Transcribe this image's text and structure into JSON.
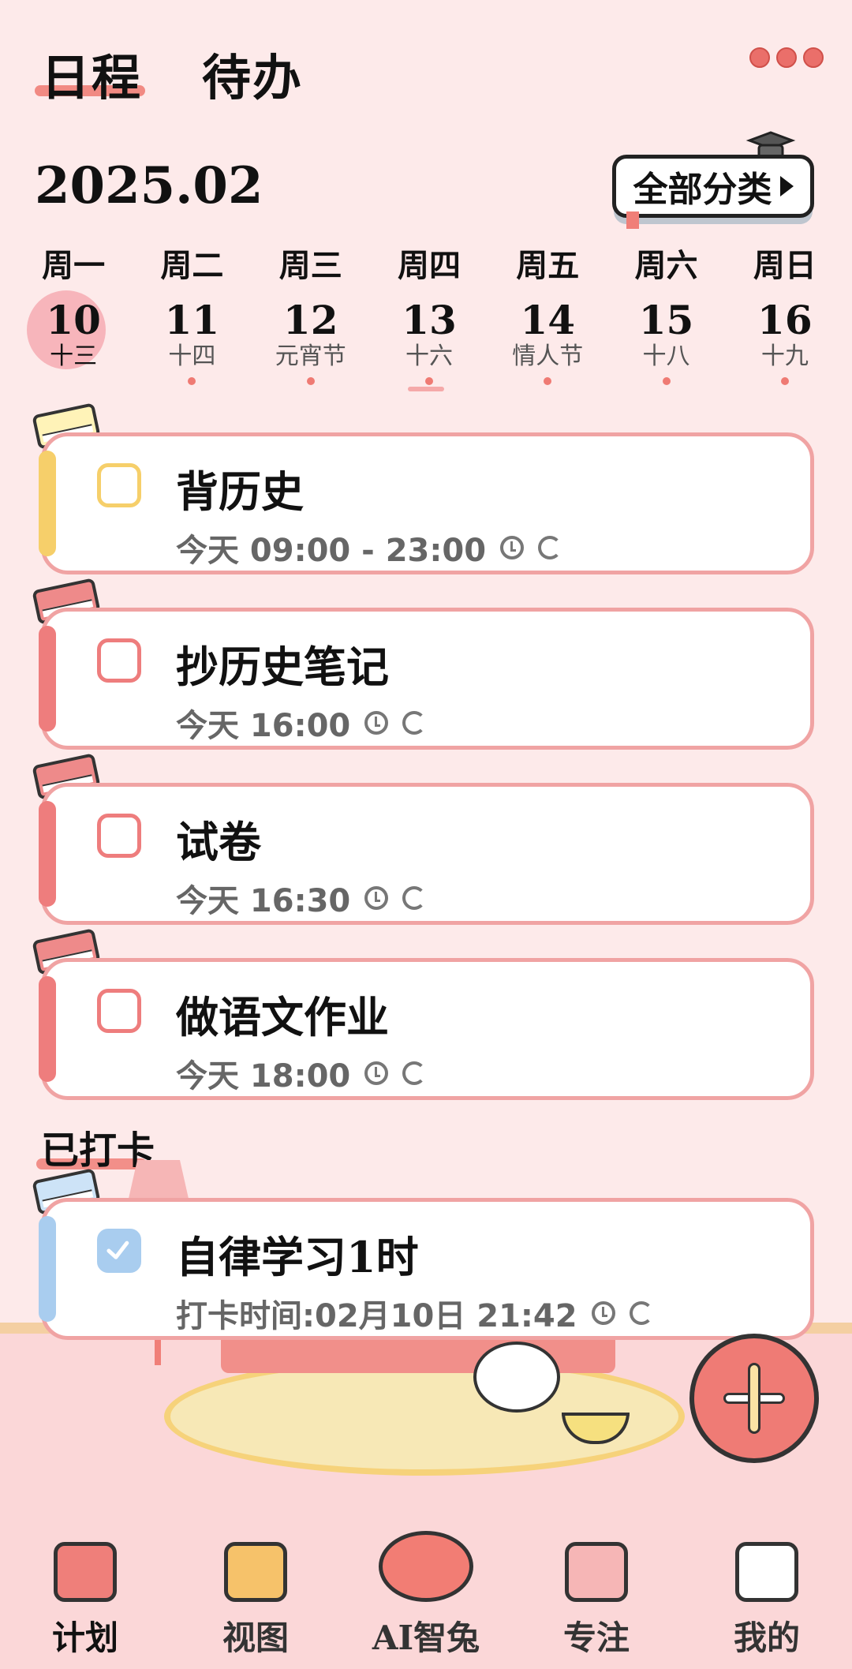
{
  "header": {
    "tabs": [
      {
        "label": "日程",
        "active": true
      },
      {
        "label": "待办",
        "active": false
      }
    ],
    "more_icon": "more-dots-icon"
  },
  "calendar": {
    "month": "2025.02",
    "all_categories": "全部分类",
    "days": [
      {
        "weekday": "周一",
        "date": "10",
        "sub": "十三",
        "today": true,
        "has_dot": false
      },
      {
        "weekday": "周二",
        "date": "11",
        "sub": "十四",
        "today": false,
        "has_dot": true
      },
      {
        "weekday": "周三",
        "date": "12",
        "sub": "元宵节",
        "today": false,
        "has_dot": true
      },
      {
        "weekday": "周四",
        "date": "13",
        "sub": "十六",
        "today": false,
        "has_dot": true
      },
      {
        "weekday": "周五",
        "date": "14",
        "sub": "情人节",
        "today": false,
        "has_dot": true
      },
      {
        "weekday": "周六",
        "date": "15",
        "sub": "十八",
        "today": false,
        "has_dot": true
      },
      {
        "weekday": "周日",
        "date": "16",
        "sub": "十九",
        "today": false,
        "has_dot": true
      }
    ]
  },
  "tasks": [
    {
      "title": "背历史",
      "meta": "今天 09:00 - 23:00",
      "color": "#f6cf6a",
      "book_color": "#fff3b8"
    },
    {
      "title": "抄历史笔记",
      "meta": "今天 16:00",
      "color": "#ee7d7d",
      "book_color": "#ee8a8a"
    },
    {
      "title": "试卷",
      "meta": "今天 16:30",
      "color": "#ee7d7d",
      "book_color": "#ee8a8a"
    },
    {
      "title": "做语文作业",
      "meta": "今天 18:00",
      "color": "#ee7d7d",
      "book_color": "#ee8a8a"
    }
  ],
  "punched": {
    "heading": "已打卡",
    "item": {
      "title": "自律学习1时",
      "meta": "打卡时间:02月10日 21:42",
      "color": "#a9cdef",
      "book_color": "#cde3f7"
    }
  },
  "nav": [
    {
      "label": "计划",
      "icon": "planner-book-icon",
      "active": true
    },
    {
      "label": "视图",
      "icon": "pencil-cup-icon",
      "active": false
    },
    {
      "label": "AI智兔",
      "icon": "ai-bunny-icon",
      "active": false
    },
    {
      "label": "专注",
      "icon": "focus-board-icon",
      "active": false
    },
    {
      "label": "我的",
      "icon": "bunny-profile-icon",
      "active": false
    }
  ],
  "fab_icon": "add-pencil-icon"
}
